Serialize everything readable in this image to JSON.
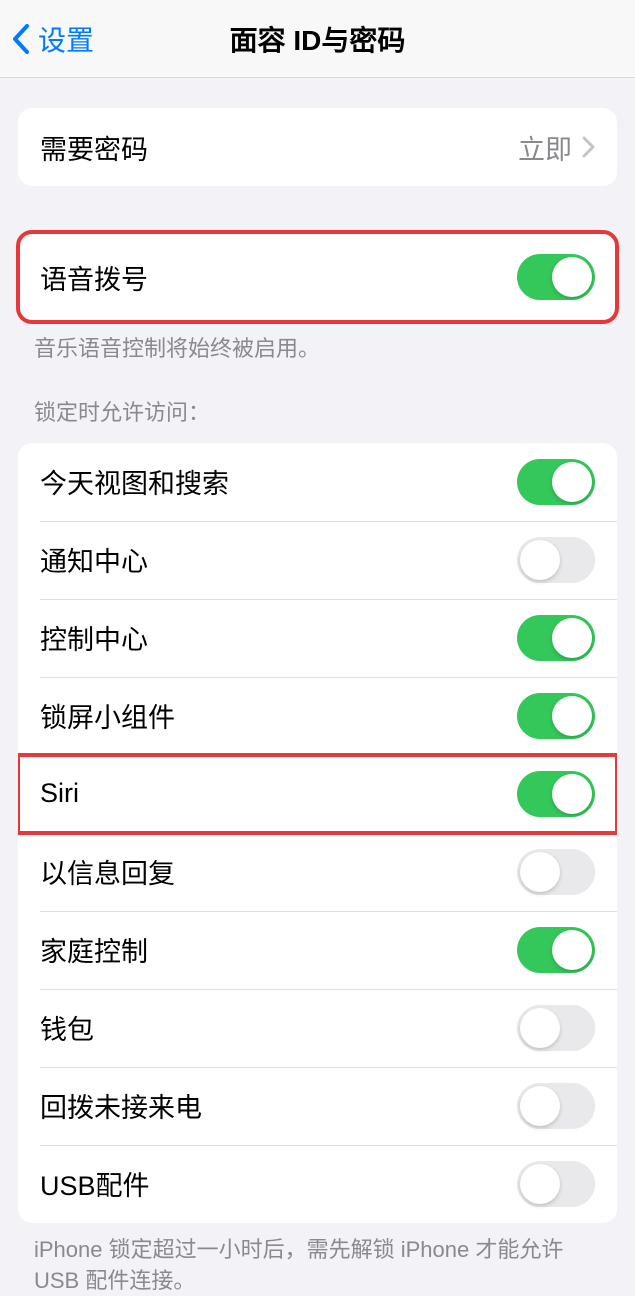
{
  "nav": {
    "back_label": "设置",
    "title": "面容 ID与密码"
  },
  "require_passcode": {
    "label": "需要密码",
    "value": "立即"
  },
  "voice_dial": {
    "label": "语音拨号",
    "on": true,
    "footer": "音乐语音控制将始终被启用。"
  },
  "lock_access": {
    "header": "锁定时允许访问：",
    "items": [
      {
        "label": "今天视图和搜索",
        "on": true,
        "highlight": false
      },
      {
        "label": "通知中心",
        "on": false,
        "highlight": false
      },
      {
        "label": "控制中心",
        "on": true,
        "highlight": false
      },
      {
        "label": "锁屏小组件",
        "on": true,
        "highlight": false
      },
      {
        "label": "Siri",
        "on": true,
        "highlight": true
      },
      {
        "label": "以信息回复",
        "on": false,
        "highlight": false
      },
      {
        "label": "家庭控制",
        "on": true,
        "highlight": false
      },
      {
        "label": "钱包",
        "on": false,
        "highlight": false
      },
      {
        "label": "回拨未接来电",
        "on": false,
        "highlight": false
      },
      {
        "label": "USB配件",
        "on": false,
        "highlight": false
      }
    ],
    "footer": "iPhone 锁定超过一小时后，需先解锁 iPhone 才能允许 USB 配件连接。"
  }
}
